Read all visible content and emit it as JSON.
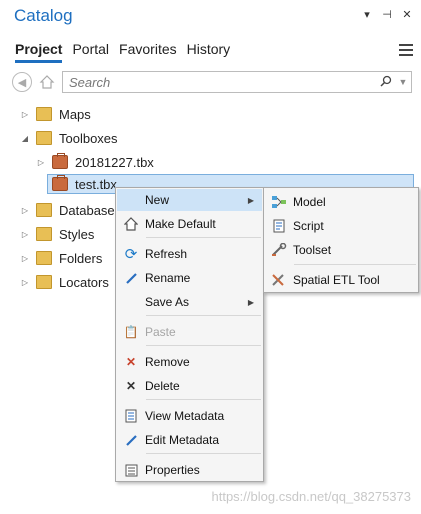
{
  "window": {
    "title": "Catalog"
  },
  "tabs": [
    {
      "label": "Project"
    },
    {
      "label": "Portal"
    },
    {
      "label": "Favorites"
    },
    {
      "label": "History"
    }
  ],
  "search": {
    "placeholder": "Search"
  },
  "tree": {
    "maps": "Maps",
    "toolboxes": "Toolboxes",
    "tbx1": "20181227.tbx",
    "tbx2": "test.tbx",
    "databases": "Databases",
    "styles": "Styles",
    "folders": "Folders",
    "locators": "Locators"
  },
  "context_menu": {
    "new": "New",
    "make_default": "Make Default",
    "refresh": "Refresh",
    "rename": "Rename",
    "save_as": "Save As",
    "paste": "Paste",
    "remove": "Remove",
    "delete": "Delete",
    "view_metadata": "View Metadata",
    "edit_metadata": "Edit Metadata",
    "properties": "Properties"
  },
  "submenu": {
    "model": "Model",
    "script": "Script",
    "toolset": "Toolset",
    "spatial_etl": "Spatial ETL Tool"
  },
  "watermark": "https://blog.csdn.net/qq_38275373",
  "colors": {
    "accent": "#1e6fc0",
    "highlight": "#cde3f7"
  }
}
